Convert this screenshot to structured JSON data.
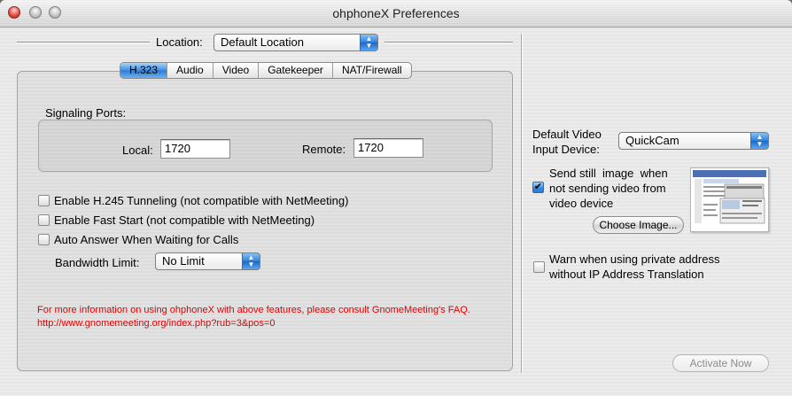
{
  "window": {
    "title": "ohphoneX Preferences"
  },
  "location": {
    "label": "Location:",
    "value": "Default Location"
  },
  "tabs": [
    {
      "label": "H.323",
      "active": true
    },
    {
      "label": "Audio",
      "active": false
    },
    {
      "label": "Video",
      "active": false
    },
    {
      "label": "Gatekeeper",
      "active": false
    },
    {
      "label": "NAT/Firewall",
      "active": false
    }
  ],
  "signaling": {
    "title": "Signaling Ports:",
    "local_label": "Local:",
    "local_value": "1720",
    "remote_label": "Remote:",
    "remote_value": "1720"
  },
  "options": {
    "h245": {
      "label": "Enable H.245 Tunneling (not compatible with NetMeeting)",
      "checked": false
    },
    "fast_start": {
      "label": "Enable Fast Start (not compatible with NetMeeting)",
      "checked": false
    },
    "auto_answer": {
      "label": "Auto Answer When Waiting for Calls",
      "checked": false
    }
  },
  "bandwidth": {
    "label": "Bandwidth Limit:",
    "value": "No Limit"
  },
  "info_text": "For more information on using ohphoneX with above features, please consult GnomeMeeting's FAQ. http://www.gnomemeeting.org/index.php?rub=3&pos=0",
  "video": {
    "device_label_line1": "Default Video",
    "device_label_line2": "Input Device:",
    "device_value": "QuickCam",
    "still_image": {
      "label_line1": "Send still  image  when",
      "label_line2": "not sending video from",
      "label_line3": "video device",
      "checked": true
    },
    "choose_image_label": "Choose Image..."
  },
  "warn_private": {
    "label_line1": "Warn when using private address",
    "label_line2": "without IP Address Translation",
    "checked": false
  },
  "activate_label": "Activate Now",
  "colors": {
    "info_text": "#e00000",
    "accent_blue": "#2e7fd9"
  }
}
